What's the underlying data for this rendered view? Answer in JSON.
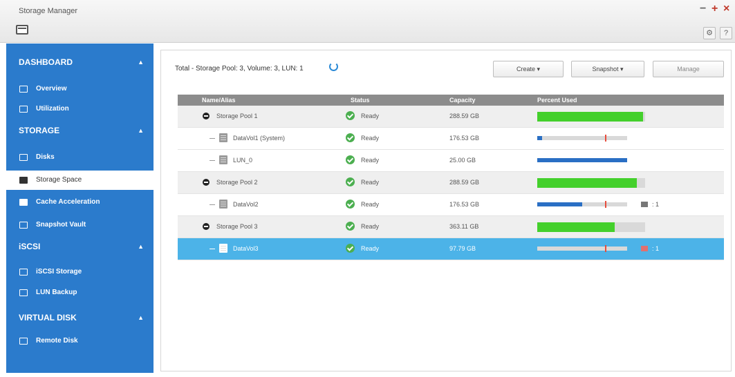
{
  "window": {
    "title": "Storage Manager",
    "controls": [
      "minimize",
      "maximize",
      "close"
    ]
  },
  "toolbar_icons": [
    "gear-icon",
    "help-icon"
  ],
  "sidebar": {
    "sections": [
      {
        "label": "DASHBOARD",
        "items": [
          {
            "label": "Overview",
            "icon": "overview-icon"
          },
          {
            "label": "Utilization",
            "icon": "utilization-icon"
          }
        ]
      },
      {
        "label": "STORAGE",
        "items": [
          {
            "label": "Disks",
            "icon": "disks-icon"
          },
          {
            "label": "Storage Space",
            "icon": "storage-space-icon",
            "active": true
          },
          {
            "label": "Cache Acceleration",
            "icon": "cache-icon"
          },
          {
            "label": "Snapshot Vault",
            "icon": "snapshot-vault-icon"
          }
        ]
      },
      {
        "label": "iSCSI",
        "items": [
          {
            "label": "iSCSI Storage",
            "icon": "iscsi-storage-icon"
          },
          {
            "label": "LUN Backup",
            "icon": "lun-backup-icon"
          }
        ]
      },
      {
        "label": "VIRTUAL DISK",
        "items": [
          {
            "label": "Remote Disk",
            "icon": "remote-disk-icon"
          }
        ]
      }
    ]
  },
  "main": {
    "summary": "Total - Storage Pool: 3, Volume: 3, LUN: 1",
    "buttons": {
      "create": "Create  ▾",
      "snapshot": "Snapshot  ▾",
      "manage": "Manage"
    },
    "columns": [
      "Name/Alias",
      "Status",
      "Capacity",
      "Percent Used"
    ],
    "rows": [
      {
        "type": "pool",
        "name": "Storage Pool 1",
        "status": "Ready",
        "capacity": "288.59 GB",
        "percent_used": 0.98,
        "bar_color": "#44d02c"
      },
      {
        "type": "volume",
        "name": "DataVol1 (System)",
        "status": "Ready",
        "capacity": "176.53 GB",
        "percent_used": 0.05,
        "threshold": 0.75,
        "bar_color": "#2a6fc4"
      },
      {
        "type": "lun",
        "name": "LUN_0",
        "status": "Ready",
        "capacity": "25.00 GB",
        "percent_used": 1.0,
        "bar_color": "#2a6fc4"
      },
      {
        "type": "pool",
        "name": "Storage Pool 2",
        "status": "Ready",
        "capacity": "288.59 GB",
        "percent_used": 0.92,
        "bar_color": "#44d02c"
      },
      {
        "type": "volume",
        "name": "DataVol2",
        "status": "Ready",
        "capacity": "176.53 GB",
        "percent_used": 0.5,
        "threshold": 0.75,
        "bar_color": "#2a6fc4",
        "snapshots": "1"
      },
      {
        "type": "pool",
        "name": "Storage Pool 3",
        "status": "Ready",
        "capacity": "363.11 GB",
        "percent_used": 0.72,
        "bar_color": "#44d02c"
      },
      {
        "type": "volume",
        "name": "DataVol3",
        "status": "Ready",
        "capacity": "97.79 GB",
        "percent_used": 0.0,
        "threshold": 0.75,
        "bar_color": "#2a6fc4",
        "snapshots": "1",
        "selected": true
      }
    ]
  }
}
